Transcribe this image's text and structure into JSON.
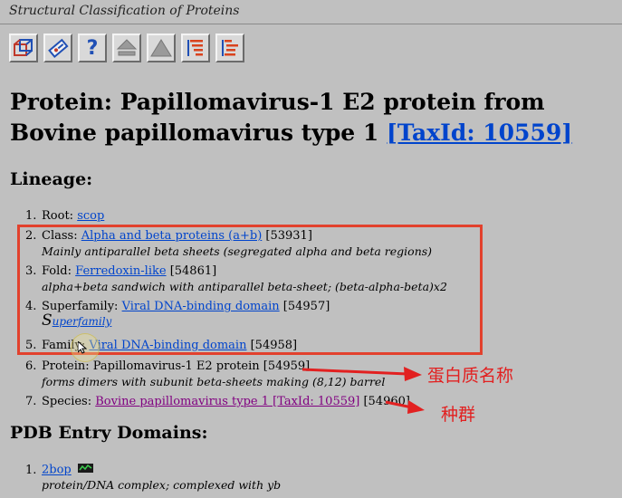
{
  "window": {
    "title": "Structural Classification of Proteins"
  },
  "toolbar": {
    "buttons": [
      {
        "icon": "scop-cube-icon"
      },
      {
        "icon": "search-tag-icon"
      },
      {
        "icon": "help-icon",
        "glyph": "?"
      },
      {
        "icon": "up-arrow-icon"
      },
      {
        "icon": "top-arrow-icon"
      },
      {
        "icon": "lineage-tree-icon"
      },
      {
        "icon": "hierarchy-tree-icon"
      }
    ]
  },
  "heading": {
    "prefix": "Protein: Papillomavirus-1 E2 protein from Bovine papillomavirus type 1 ",
    "taxid_link": "[TaxId: 10559]"
  },
  "lineage": {
    "title": "Lineage:",
    "items": [
      {
        "num": "1.",
        "label": "Root: ",
        "link": "scop",
        "id": ""
      },
      {
        "num": "2.",
        "label": "Class: ",
        "link": "Alpha and beta proteins (a+b)",
        "id": " [53931]",
        "desc": "Mainly antiparallel beta sheets (segregated alpha and beta regions)"
      },
      {
        "num": "3.",
        "label": "Fold: ",
        "link": "Ferredoxin-like",
        "id": " [54861]",
        "desc": "alpha+beta sandwich with antiparallel beta-sheet; (beta-alpha-beta)x2"
      },
      {
        "num": "4.",
        "label": "Superfamily: ",
        "link": "Viral DNA-binding domain",
        "id": " [54957]",
        "logo_letter": "S",
        "logo_link": "uperfamily"
      },
      {
        "num": "5.",
        "label": "Family: ",
        "link": "Viral DNA-binding domain",
        "id": " [54958]"
      },
      {
        "num": "6.",
        "label": "Protein: Papillomavirus-1 E2 protein",
        "link": "",
        "id": " [54959]",
        "desc": "forms dimers with subunit beta-sheets making (8,12) barrel"
      },
      {
        "num": "7.",
        "label": "Species: ",
        "link": "Bovine papillomavirus type 1 [TaxId: 10559]",
        "id": " [54960]"
      }
    ]
  },
  "pdb": {
    "title": "PDB Entry Domains:",
    "items": [
      {
        "num": "1.",
        "link": "2bop",
        "desc": "protein/DNA complex; complexed with yb"
      }
    ]
  },
  "annotations": {
    "protein_name": "蛋白质名称",
    "species": "种群",
    "color": "#e22020",
    "box_color": "#e2412d"
  }
}
